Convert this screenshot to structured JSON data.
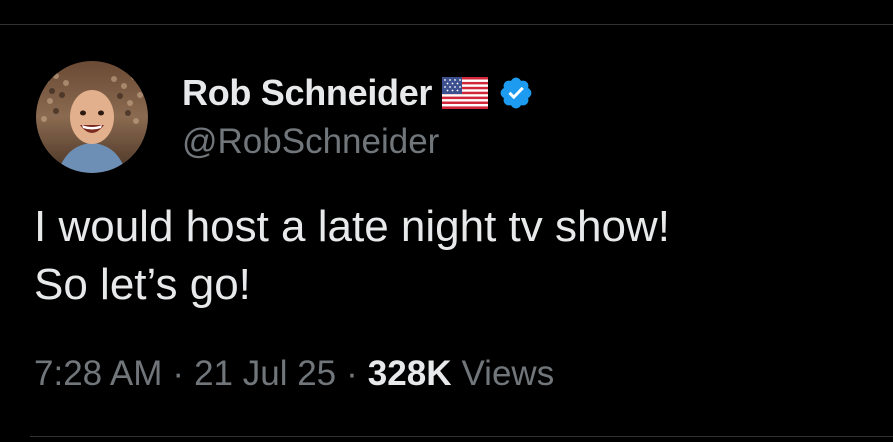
{
  "tweet": {
    "author": {
      "display_name": "Rob Schneider",
      "handle": "@RobSchneider",
      "flag_emoji": "us-flag-icon",
      "verified": true,
      "verified_color": "#1d9bf0"
    },
    "text": "I would host a late night tv show!\nSo let’s go!",
    "meta": {
      "time": "7:28 AM",
      "separator": "·",
      "date": "21 Jul 25",
      "views_count": "328K",
      "views_label": "Views"
    }
  },
  "theme": {
    "background": "#000000",
    "primary_text": "#e7e9ea",
    "secondary_text": "#71767b"
  }
}
